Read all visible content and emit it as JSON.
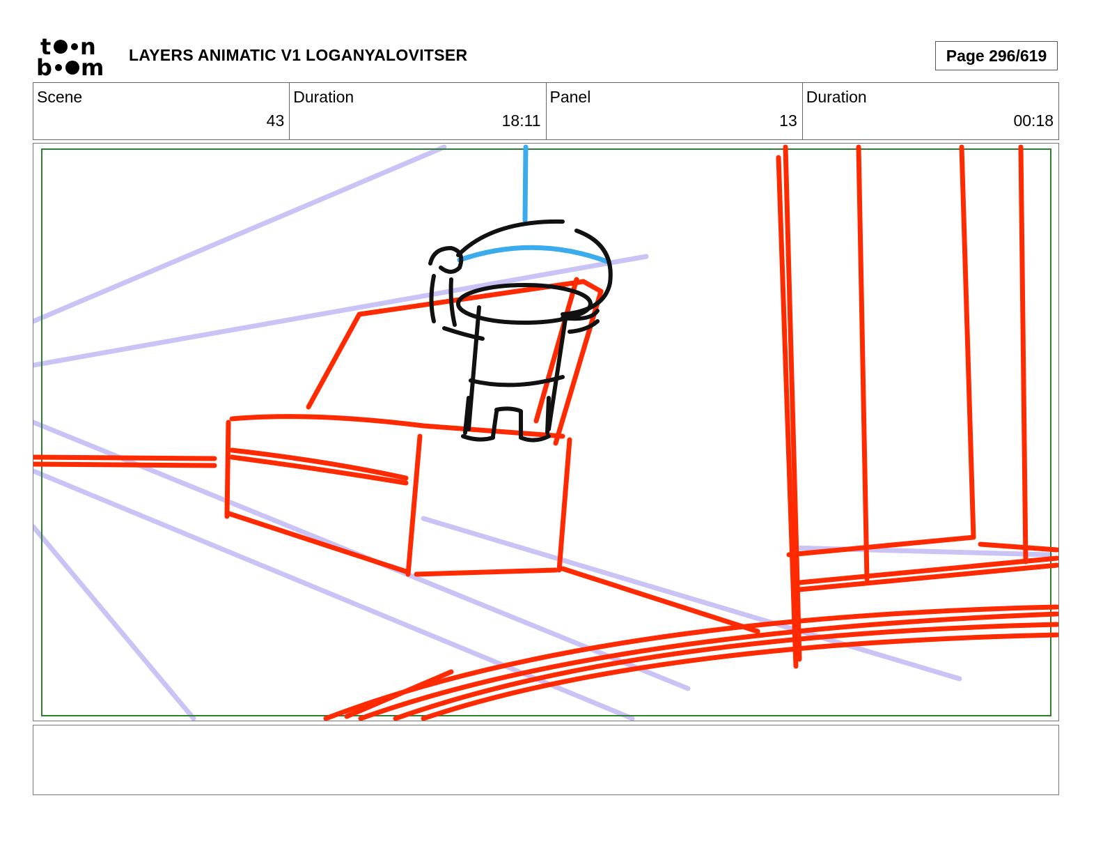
{
  "header": {
    "logo_text": "toon boom",
    "title": "LAYERS ANIMATIC V1 LOGANYALOVITSER",
    "page_label": "Page 296/619"
  },
  "info": {
    "scene_label": "Scene",
    "scene_value": "43",
    "scene_duration_label": "Duration",
    "scene_duration_value": "18:11",
    "panel_label": "Panel",
    "panel_value": "13",
    "panel_duration_label": "Duration",
    "panel_duration_value": "00:18"
  },
  "panel": {
    "image": "storyboard-sketch",
    "safe_frame_color": "#2e7d32",
    "layer_colors": {
      "perspective": "#c9c4f5",
      "layout": "#ff2a00",
      "character": "#111111",
      "rope": "#3aabec"
    }
  },
  "caption": {
    "text": ""
  }
}
